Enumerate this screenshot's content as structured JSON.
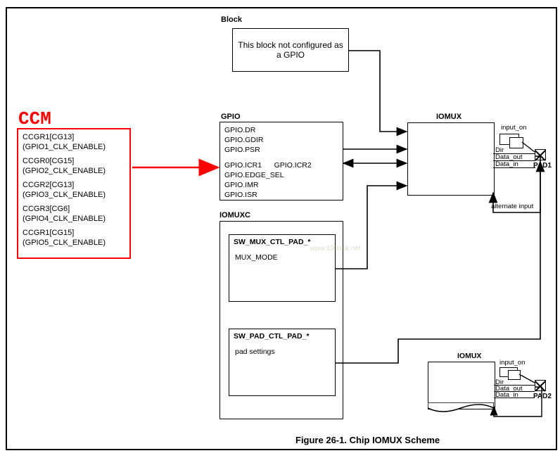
{
  "ccm": {
    "title": "CCM",
    "entries": [
      {
        "reg": "CCGR1[CG13]",
        "desc": "(GPIO1_CLK_ENABLE)"
      },
      {
        "reg": "CCGR0[CG15]",
        "desc": "(GPIO2_CLK_ENABLE)"
      },
      {
        "reg": "CCGR2[CG13]",
        "desc": "(GPIO3_CLK_ENABLE)"
      },
      {
        "reg": "CCGR3[CG6]",
        "desc": "(GPIO4_CLK_ENABLE)"
      },
      {
        "reg": "CCGR1[CG15]",
        "desc": "(GPIO5_CLK_ENABLE)"
      }
    ]
  },
  "block": {
    "label": "Block",
    "text": "This block not configured as a GPIO"
  },
  "gpio": {
    "label": "GPIO",
    "regs1": [
      "GPIO.DR",
      "GPIO.GDIR",
      "GPIO.PSR"
    ],
    "regs2": [
      "GPIO.ICR1",
      "GPIO.EDGE_SEL",
      "GPIO.IMR",
      "GPIO.ISR"
    ],
    "icr2": "GPIO.ICR2"
  },
  "iomuxc": {
    "label": "IOMUXC",
    "sw_mux": {
      "title": "SW_MUX_CTL_PAD_*",
      "field": "MUX_MODE"
    },
    "sw_pad": {
      "title": "SW_PAD_CTL_PAD_*",
      "field": "pad settings"
    }
  },
  "iomux": {
    "label": "IOMUX",
    "sigs": {
      "input_on": "input_on",
      "dir": "Dir",
      "data_out": "Data_out",
      "data_in": "Data_in",
      "alt_input": "alternate input"
    }
  },
  "pads": {
    "pad1": "PAD1",
    "pad2": "PAD2"
  },
  "caption": "Figure 26-1. Chip IOMUX Scheme",
  "watermark": "www.100ask.net"
}
